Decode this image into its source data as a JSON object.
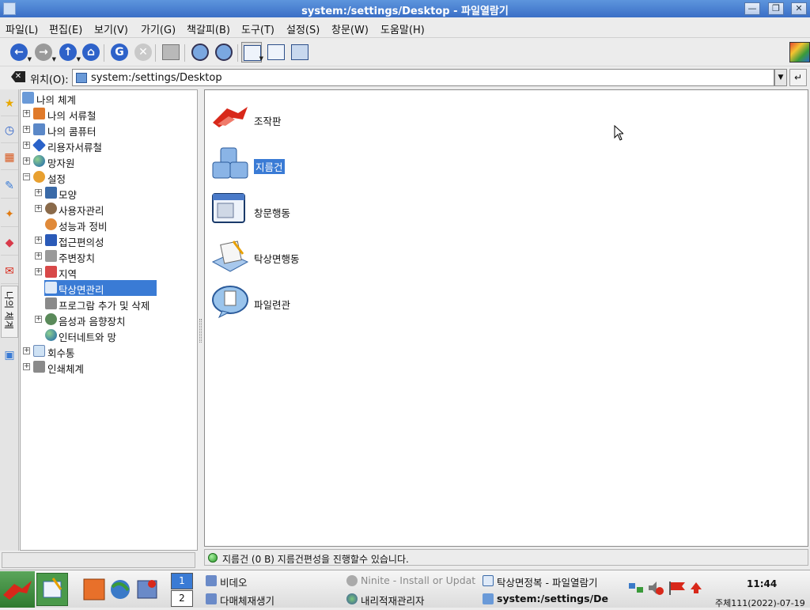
{
  "window": {
    "title": "system:/settings/Desktop - 파일열람기",
    "buttons": {
      "minimize": "—",
      "maximize": "❐",
      "close": "✕"
    }
  },
  "menu": [
    "파일(L)",
    "편집(E)",
    "보기(V)",
    "가기(G)",
    "책갈피(B)",
    "도구(T)",
    "설정(S)",
    "창문(W)",
    "도움말(H)"
  ],
  "toolbar": {
    "back_icon": "←",
    "forward_icon": "→",
    "up_icon": "↑",
    "home_icon": "⌂",
    "reload_icon": "G",
    "stop_icon": "✕"
  },
  "location": {
    "label": "위치(O):",
    "value": "system:/settings/Desktop",
    "dropdown_icon": "▼",
    "go_icon": "↵",
    "clear_icon": "✕"
  },
  "nav_strip": {
    "icons": [
      "★",
      "◷",
      "▦",
      "✎",
      "✦",
      "◆",
      "✉"
    ],
    "vertical_tab": "나의 체계"
  },
  "tree": {
    "items": [
      {
        "label": "나의 체계",
        "expander": ""
      },
      {
        "label": "나의 서류철",
        "expander": "+"
      },
      {
        "label": "나의 콤퓨터",
        "expander": "+"
      },
      {
        "label": "리용자서류철",
        "expander": "+"
      },
      {
        "label": "망자원",
        "expander": "+"
      },
      {
        "label": "설정",
        "expander": "−"
      },
      {
        "label": "모양",
        "expander": "+"
      },
      {
        "label": "사용자관리",
        "expander": "+"
      },
      {
        "label": "성능과 정비",
        "expander": ""
      },
      {
        "label": "접근편의성",
        "expander": "+"
      },
      {
        "label": "주변장치",
        "expander": "+"
      },
      {
        "label": "지역",
        "expander": "+"
      },
      {
        "label": "탁상면관리",
        "expander": ""
      },
      {
        "label": "프로그람 추가 및 삭제",
        "expander": ""
      },
      {
        "label": "음성과 음향장치",
        "expander": "+"
      },
      {
        "label": "인터네트와 망",
        "expander": ""
      },
      {
        "label": "회수통",
        "expander": "+"
      },
      {
        "label": "인쇄체계",
        "expander": "+"
      }
    ]
  },
  "content": {
    "items": [
      {
        "label": "조작판"
      },
      {
        "label": "지름건"
      },
      {
        "label": "창문행동"
      },
      {
        "label": "탁상면행동"
      },
      {
        "label": "파일련관"
      }
    ]
  },
  "status": {
    "text": "지름건 (0 B)  지름건편성을 진행할수 있습니다."
  },
  "taskbar": {
    "pagers": [
      "1",
      "2"
    ],
    "tasks": [
      {
        "label": "비데오"
      },
      {
        "label": "다매체재생기"
      },
      {
        "label": "Ninite - Install or Updat"
      },
      {
        "label": "내리적재관리자"
      },
      {
        "label": "탁상면정복 - 파일열람기"
      },
      {
        "label": "system:/settings/De"
      }
    ],
    "clock": "11:44",
    "date": "주체111(2022)-07-19"
  }
}
